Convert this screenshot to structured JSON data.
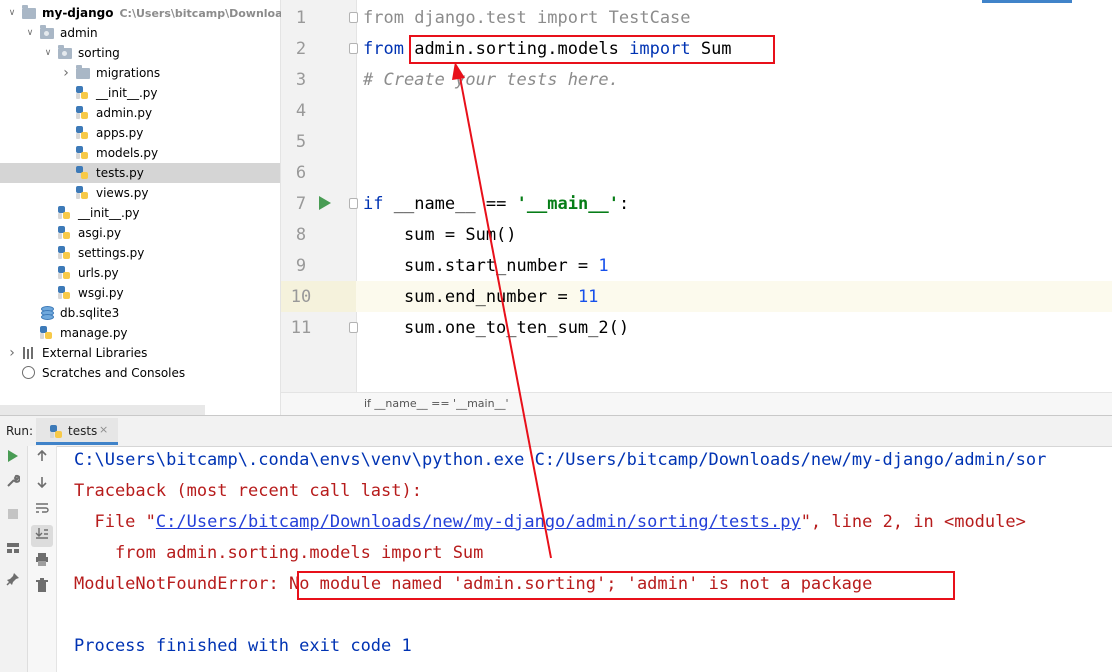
{
  "tree": {
    "items": [
      {
        "label": "my-django",
        "hint": "C:\\Users\\bitcamp\\Downloads",
        "type": "folder",
        "arrow": "open"
      },
      {
        "label": "admin",
        "type": "folder",
        "arrow": "open"
      },
      {
        "label": "sorting",
        "type": "folder",
        "arrow": "open"
      },
      {
        "label": "migrations",
        "type": "folder",
        "arrow": "closed"
      },
      {
        "label": "__init__.py",
        "type": "py"
      },
      {
        "label": "admin.py",
        "type": "py"
      },
      {
        "label": "apps.py",
        "type": "py"
      },
      {
        "label": "models.py",
        "type": "py"
      },
      {
        "label": "tests.py",
        "type": "py"
      },
      {
        "label": "views.py",
        "type": "py"
      },
      {
        "label": "__init__.py",
        "type": "py"
      },
      {
        "label": "asgi.py",
        "type": "py"
      },
      {
        "label": "settings.py",
        "type": "py"
      },
      {
        "label": "urls.py",
        "type": "py"
      },
      {
        "label": "wsgi.py",
        "type": "py"
      },
      {
        "label": "db.sqlite3",
        "type": "db"
      },
      {
        "label": "manage.py",
        "type": "py"
      },
      {
        "label": "External Libraries",
        "type": "libs",
        "arrow": "closed"
      },
      {
        "label": "Scratches and Consoles",
        "type": "scratch"
      }
    ]
  },
  "editor": {
    "line_numbers": [
      "1",
      "2",
      "3",
      "4",
      "5",
      "6",
      "7",
      "8",
      "9",
      "10",
      "11"
    ],
    "lines": {
      "l1_from": "from",
      "l1_rest": " django.test import TestCase",
      "l2_from": "from",
      "l2_module": "admin.sorting.models",
      "l2_import": "import",
      "l2_name": "Sum",
      "l3_comment": "# Create your tests here.",
      "l7_if": "if",
      "l7_name": "__name__",
      "l7_eq": " == ",
      "l7_str": "'__main__'",
      "l7_colon": ":",
      "l8": "    sum = Sum()",
      "l9_a": "    sum.start_number = ",
      "l9_num": "1",
      "l10_a": "    sum.end_number = ",
      "l10_num": "11",
      "l11": "    sum.one_to_ten_sum_2()"
    },
    "breadcrumb": "if __name__ == '__main__'"
  },
  "run_panel": {
    "label": "Run:",
    "tab_label": "tests",
    "tab_close": "×",
    "output": {
      "cmd": "C:\\Users\\bitcamp\\.conda\\envs\\venv\\python.exe C:/Users/bitcamp/Downloads/new/my-django/admin/sor",
      "traceback": "Traceback (most recent call last):",
      "file_prefix": "  File \"",
      "file_link": "C:/Users/bitcamp/Downloads/new/my-django/admin/sorting/tests.py",
      "file_suffix": "\", line 2, in <module>",
      "code_line": "    from admin.sorting.models import Sum",
      "error_type": "ModuleNotFoundError:",
      "error_msg": "No module named 'admin.sorting'; 'admin' is not a package",
      "finished": "Process finished with exit code 1"
    }
  },
  "icons": {
    "rerun": "play-icon",
    "wrench": "wrench-icon",
    "stop": "stop-icon",
    "layout": "layout-icon",
    "pin": "pin-icon",
    "up": "arrow-up-icon",
    "down": "arrow-down-icon",
    "wrap": "soft-wrap-icon",
    "scroll": "scroll-to-end-icon",
    "print": "print-icon",
    "trash": "trash-icon"
  },
  "colors": {
    "accent": "#4083c9",
    "error": "#b71c1c",
    "annotation": "#e8101a",
    "run": "#499c54",
    "keyword": "#0033b3"
  }
}
